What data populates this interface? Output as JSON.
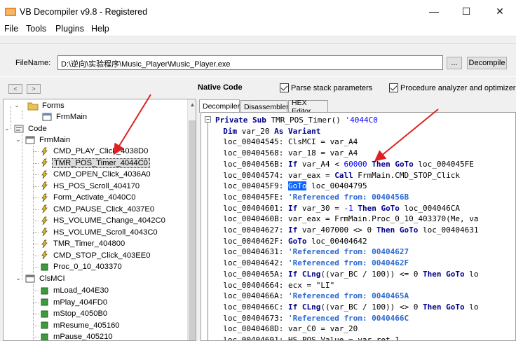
{
  "window": {
    "title": "VB Decompiler v9.8 - Registered",
    "minimize_glyph": "—",
    "maximize_glyph": "☐",
    "close_glyph": "✕"
  },
  "menu": [
    "File",
    "Tools",
    "Plugins",
    "Help"
  ],
  "toolbar": {
    "filename_label": "FileName:",
    "filename_value": "D:\\逆向\\实验程序\\Music_Player\\Music_Player.exe",
    "browse_label": "...",
    "decompile_label": "Decompile"
  },
  "nav": {
    "back_glyph": "<",
    "forward_glyph": ">",
    "native_code_label": "Native Code",
    "parse_stack_label": "Parse stack parameters",
    "procedure_analyzer_label": "Procedure analyzer and optimizer"
  },
  "tree": {
    "forms": "Forms",
    "frm_main_form": "FrmMain",
    "code": "Code",
    "frm_main": "FrmMain",
    "frm_main_items": [
      "CMD_PLAY_Click_4038D0",
      "TMR_POS_Timer_4044C0",
      "CMD_OPEN_Click_4036A0",
      "HS_POS_Scroll_404170",
      "Form_Activate_4040C0",
      "CMD_PAUSE_Click_4037E0",
      "HS_VOLUME_Change_4042C0",
      "HS_VOLUME_Scroll_4043C0",
      "TMR_Timer_404800",
      "CMD_STOP_Click_403EE0",
      "Proc_0_10_403370"
    ],
    "clsmci": "ClsMCI",
    "clsmci_items": [
      "mLoad_404E30",
      "mPlay_404FD0",
      "mStop_4050B0",
      "mResume_405160",
      "mPause_405210"
    ],
    "selected_item": "TMR_POS_Timer_4044C0"
  },
  "tabs": [
    "Decompiler",
    "Disassembler",
    "HEX Editor"
  ],
  "active_tab": "Decompiler",
  "code_lines": [
    "Private Sub TMR_POS_Timer() '4044C0",
    "  Dim var_20 As Variant",
    "  loc_00404545: ClsMCI = var_A4",
    "  loc_00404568: var_18 = var_A4",
    "  loc_0040456B: If var_A4 < 60000 Then GoTo loc_004045FE",
    "  loc_00404574: var_eax = Call FrmMain.CMD_STOP_Click",
    "  loc_004045F9: GoTo loc_00404795",
    "  loc_004045FE: 'Referenced from: 0040456B",
    "  loc_00404601: If var_30 = -1 Then GoTo loc_004046CA",
    "  loc_0040460B: var_eax = FrmMain.Proc_0_10_403370(Me, va",
    "  loc_00404627: If var_407000 <> 0 Then GoTo loc_00404631",
    "  loc_0040462F: GoTo loc_00404642",
    "  loc_00404631: 'Referenced from: 00404627",
    "  loc_00404642: 'Referenced from: 0040462F",
    "  loc_0040465A: If CLng((var_BC / 100)) <= 0 Then GoTo lo",
    "  loc_00404664: ecx = \"LI\"",
    "  loc_0040466A: 'Referenced from: 0040465A",
    "  loc_0040466C: If CLng((var_BC / 100)) <> 0 Then GoTo lo",
    "  loc_00404673: 'Referenced from: 0040466C",
    "  loc_0040468D: var_C0 = var_20",
    "  loc_00404691: HS_POS.Value = var_ret_1"
  ],
  "accent_colors": {
    "keyword": "#00008b",
    "number": "#0000ff",
    "comment": "#2d6ad1",
    "selection": "#0a64ff",
    "annotation_arrow": "#e02020"
  }
}
